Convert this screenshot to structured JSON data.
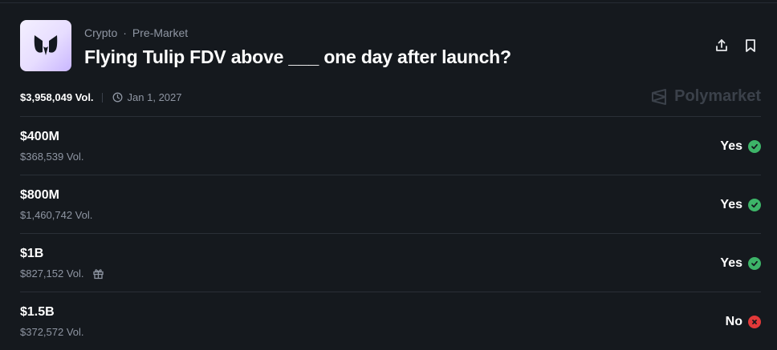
{
  "market": {
    "category": "Crypto",
    "separator": "·",
    "subcategory": "Pre-Market",
    "title": "Flying Tulip FDV above ___ one day after launch?",
    "total_volume": "$3,958,049 Vol.",
    "end_date": "Jan 1, 2027",
    "brand": "Polymarket"
  },
  "icons": {
    "share": "share-icon",
    "bookmark": "bookmark-icon",
    "calendar": "clock-icon",
    "gift": "gift-icon",
    "yes": "check-icon",
    "no": "x-icon"
  },
  "colors": {
    "background": "#15191e",
    "yes": "#3db468",
    "no": "#e23939",
    "muted": "#8f96a3"
  },
  "outcomes": [
    {
      "label": "$400M",
      "volume": "$368,539 Vol.",
      "result": "Yes",
      "resolved_yes": true,
      "gift": false
    },
    {
      "label": "$800M",
      "volume": "$1,460,742 Vol.",
      "result": "Yes",
      "resolved_yes": true,
      "gift": false
    },
    {
      "label": "$1B",
      "volume": "$827,152 Vol.",
      "result": "Yes",
      "resolved_yes": true,
      "gift": true
    },
    {
      "label": "$1.5B",
      "volume": "$372,572 Vol.",
      "result": "No",
      "resolved_yes": false,
      "gift": false
    }
  ]
}
